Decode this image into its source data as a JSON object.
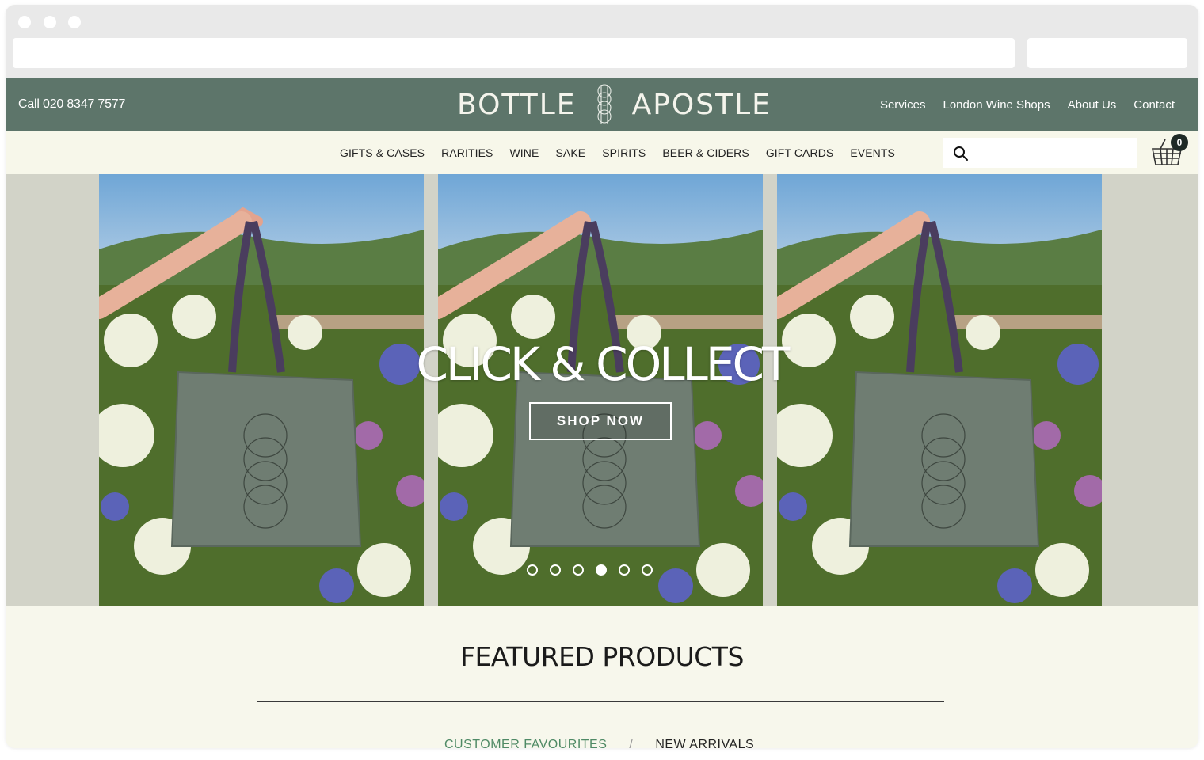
{
  "header": {
    "phone": "Call 020 8347 7577",
    "logo_left": "BOTTLE",
    "logo_right": "APOSTLE",
    "links": [
      "Services",
      "London Wine Shops",
      "About Us",
      "Contact"
    ]
  },
  "nav": {
    "categories": [
      "GIFTS & CASES",
      "RARITIES",
      "WINE",
      "SAKE",
      "SPIRITS",
      "BEER & CIDERS",
      "GIFT CARDS",
      "EVENTS"
    ],
    "search_value": "",
    "basket_count": "0"
  },
  "hero": {
    "title": "CLICK & COLLECT",
    "button_label": "SHOP NOW",
    "slide_count": 6,
    "active_slide": 4
  },
  "featured": {
    "title": "FEATURED PRODUCTS",
    "tabs": [
      "CUSTOMER FAVOURITES",
      "NEW ARRIVALS"
    ],
    "separator": "/"
  },
  "colors": {
    "header_green": "#5d756a",
    "nav_cream": "#f7f7ea",
    "tab_active": "#4f8a66"
  }
}
